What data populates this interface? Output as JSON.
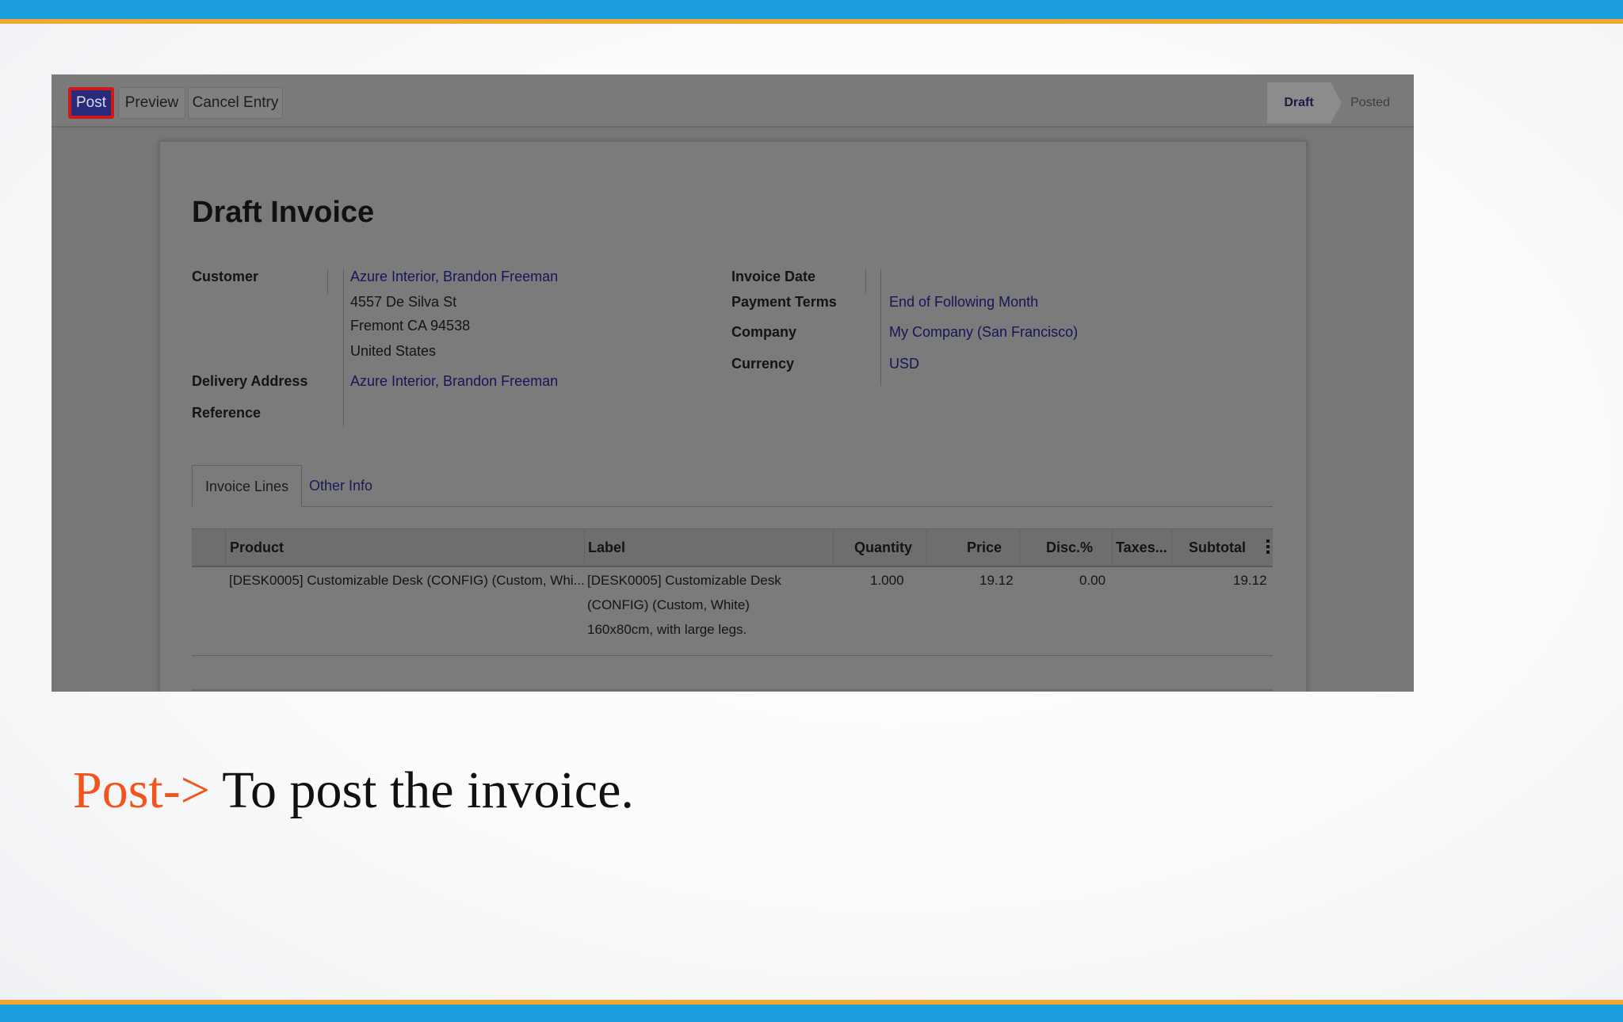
{
  "caption": {
    "keyword": "Post->",
    "text": " To post the invoice."
  },
  "toolbar": {
    "post_label": "Post",
    "preview_label": "Preview",
    "cancel_label": "Cancel Entry"
  },
  "status": {
    "stages": [
      "Draft",
      "Posted"
    ],
    "current": "Draft"
  },
  "invoice": {
    "title": "Draft Invoice",
    "customer_label": "Customer",
    "customer_name": "Azure Interior, Brandon Freeman",
    "address_line1": "4557 De Silva St",
    "address_line2": "Fremont CA 94538",
    "address_line3": "United States",
    "delivery_label": "Delivery Address",
    "delivery_value": "Azure Interior, Brandon Freeman",
    "reference_label": "Reference",
    "invoice_date_label": "Invoice Date",
    "payment_terms_label": "Payment Terms",
    "payment_terms_value": "End of Following Month",
    "company_label": "Company",
    "company_value": "My Company (San Francisco)",
    "currency_label": "Currency",
    "currency_value": "USD"
  },
  "tabs": [
    "Invoice Lines",
    "Other Info"
  ],
  "table": {
    "headers": [
      "Product",
      "Label",
      "Quantity",
      "Price",
      "Disc.%",
      "Taxes...",
      "Subtotal"
    ],
    "rows": [
      {
        "product": "[DESK0005] Customizable Desk (CONFIG) (Custom, Whi...",
        "label_line1": "[DESK0005] Customizable Desk",
        "label_line2": "(CONFIG) (Custom, White)",
        "label_line3": "160x80cm, with large legs.",
        "quantity": "1.000",
        "price": "19.12",
        "discount": "0.00",
        "taxes": "",
        "subtotal": "19.12"
      }
    ]
  },
  "colors": {
    "brand_blue": "#1b9edb",
    "brand_orange": "#f2a733",
    "caption_accent": "#f2541b",
    "post_highlight": "#cc1a1a"
  }
}
